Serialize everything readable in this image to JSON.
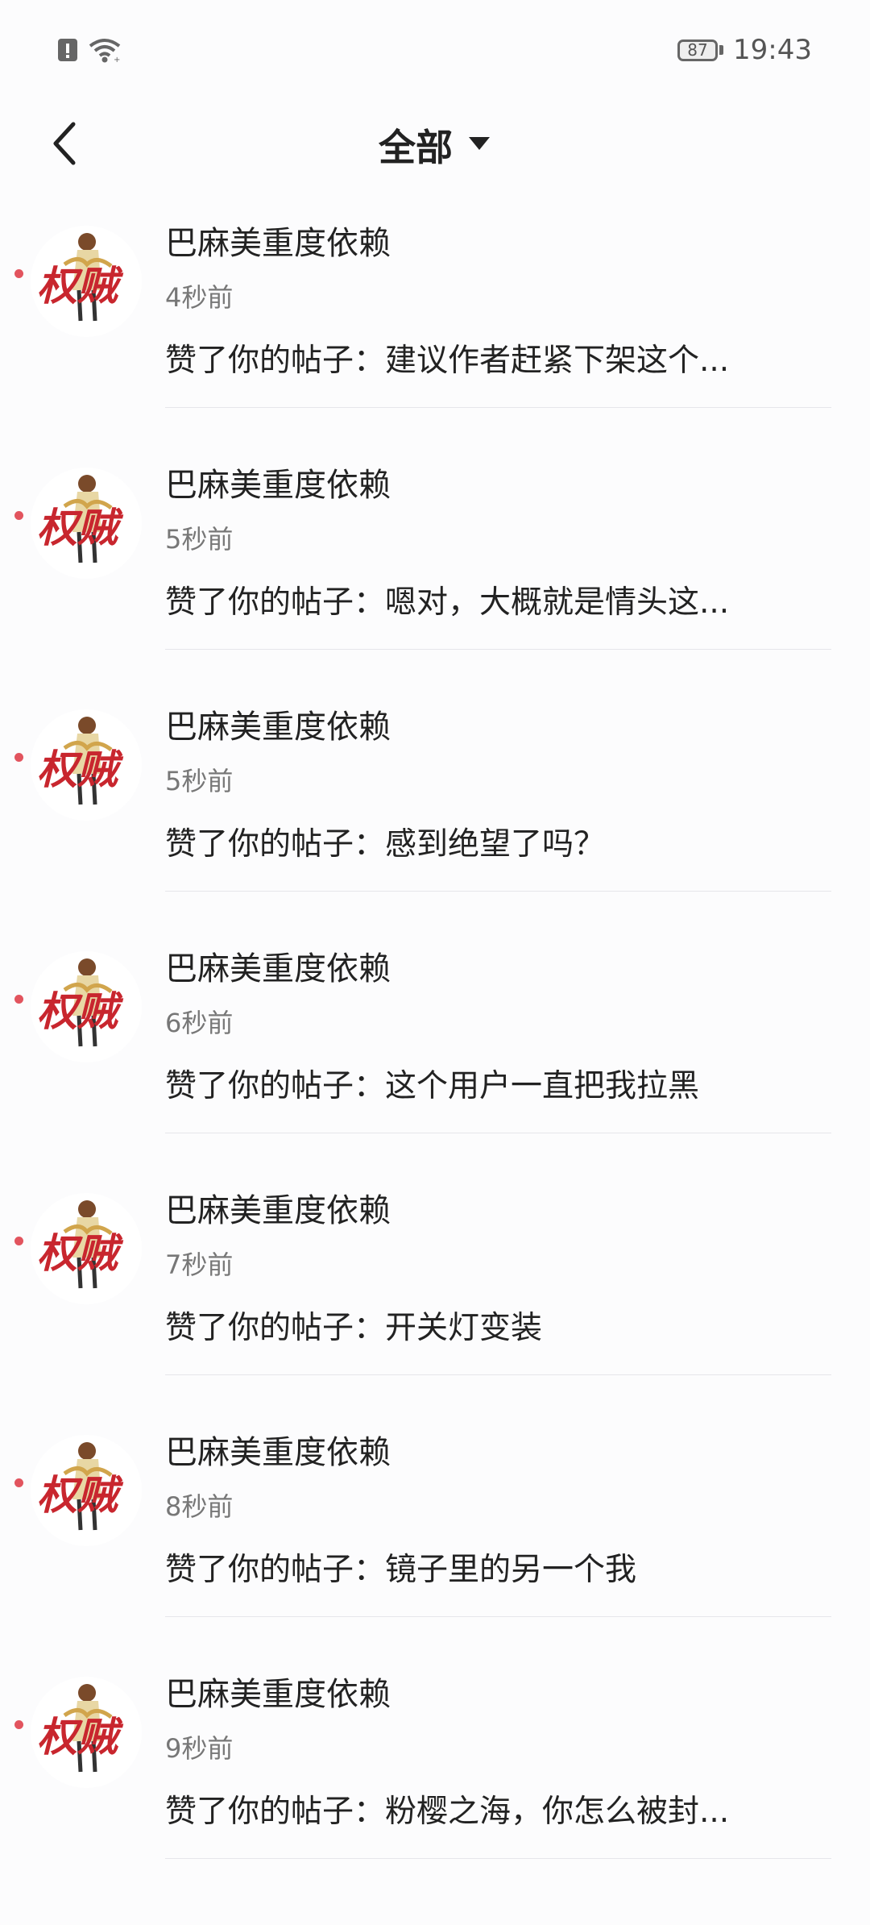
{
  "status_bar": {
    "battery": "87",
    "time": "19:43"
  },
  "header": {
    "title": "全部"
  },
  "notifications": [
    {
      "name": "巴麻美重度依赖",
      "time": "4秒前",
      "message": "赞了你的帖子：建议作者赶紧下架这个..."
    },
    {
      "name": "巴麻美重度依赖",
      "time": "5秒前",
      "message": "赞了你的帖子：嗯对，大概就是情头这..."
    },
    {
      "name": "巴麻美重度依赖",
      "time": "5秒前",
      "message": "赞了你的帖子：感到绝望了吗？"
    },
    {
      "name": "巴麻美重度依赖",
      "time": "6秒前",
      "message": "赞了你的帖子：这个用户一直把我拉黑"
    },
    {
      "name": "巴麻美重度依赖",
      "time": "7秒前",
      "message": "赞了你的帖子：开关灯变装"
    },
    {
      "name": "巴麻美重度依赖",
      "time": "8秒前",
      "message": "赞了你的帖子：镜子里的另一个我"
    },
    {
      "name": "巴麻美重度依赖",
      "time": "9秒前",
      "message": "赞了你的帖子：粉樱之海，你怎么被封..."
    }
  ],
  "avatar_logo_text": "权贼",
  "colors": {
    "unread_dot": "#e2545e",
    "avatar_text": "#c8262e"
  },
  "icons": {
    "status_alert": "alert-icon",
    "wifi": "wifi-icon",
    "back": "back-chevron-icon",
    "dropdown": "dropdown-triangle-icon"
  }
}
